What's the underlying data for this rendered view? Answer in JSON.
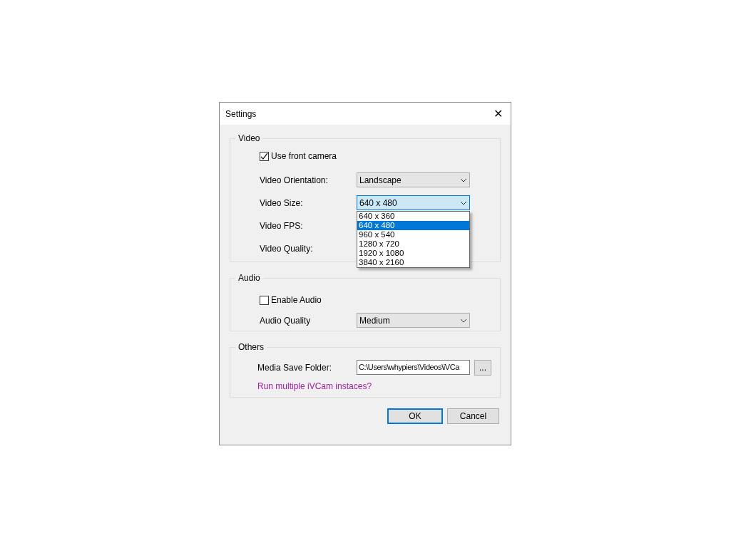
{
  "window": {
    "title": "Settings",
    "close": "✕"
  },
  "video": {
    "title": "Video",
    "use_front_camera": {
      "label": "Use front camera",
      "checked": true
    },
    "rows": [
      {
        "label": "Video Orientation:",
        "kind": "combo",
        "value": "Landscape",
        "focused": false
      },
      {
        "label": "Video Size:",
        "kind": "combo",
        "value": "640 x 480",
        "focused": true
      },
      {
        "label": "Video FPS:",
        "kind": "label"
      },
      {
        "label": "Video Quality:",
        "kind": "label"
      }
    ],
    "dropdown": [
      {
        "label": "640 x 360",
        "selected": false
      },
      {
        "label": "640 x 480",
        "selected": true
      },
      {
        "label": "960 x 540",
        "selected": false
      },
      {
        "label": "1280 x 720",
        "selected": false
      },
      {
        "label": "1920 x 1080",
        "selected": false
      },
      {
        "label": "3840 x 2160",
        "selected": false
      }
    ]
  },
  "audio": {
    "title": "Audio",
    "enable_audio": {
      "label": "Enable Audio",
      "checked": false
    },
    "quality_label": "Audio Quality",
    "quality_value": "Medium"
  },
  "others": {
    "title": "Others",
    "folder_label": "Media Save Folder:",
    "folder_value": "C:\\Users\\whypiers\\Videos\\iVCa",
    "browse": "...",
    "link": "Run multiple iVCam instaces?"
  },
  "buttons": [
    {
      "label": "OK",
      "default": true
    },
    {
      "label": "Cancel",
      "default": false
    }
  ]
}
